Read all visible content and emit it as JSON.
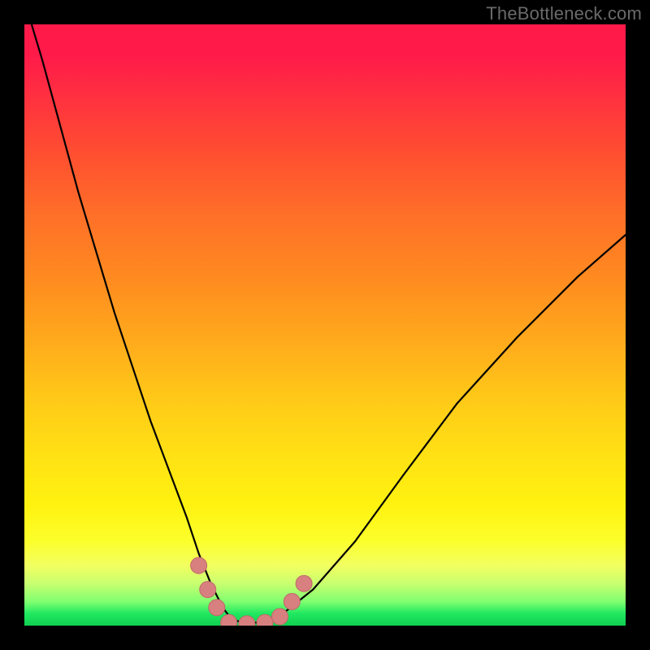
{
  "watermark": "TheBottleneck.com",
  "colors": {
    "background": "#000000",
    "curve": "#000000",
    "marker_fill": "#d88080",
    "marker_stroke": "#c06868",
    "gradient_top": "#ff1a4a",
    "gradient_bottom": "#10d050"
  },
  "chart_data": {
    "type": "line",
    "title": "",
    "xlabel": "",
    "ylabel": "",
    "xlim": [
      0,
      100
    ],
    "ylim": [
      0,
      100
    ],
    "grid": false,
    "legend": false,
    "annotations": [],
    "series": [
      {
        "name": "bottleneck-curve",
        "x": [
          0,
          3,
          6,
          9,
          12,
          15,
          18,
          21,
          24,
          27,
          29,
          31,
          33,
          34.5,
          36.5,
          39,
          43,
          48,
          55,
          63,
          72,
          82,
          92,
          100
        ],
        "values": [
          104,
          94,
          83,
          72,
          62,
          52,
          43,
          34,
          26,
          18,
          12,
          7,
          3,
          1,
          0.5,
          0.5,
          2,
          6,
          14,
          25,
          37,
          48,
          58,
          65
        ]
      }
    ],
    "markers": [
      {
        "name": "m1",
        "x": 29.0,
        "y": 10.0
      },
      {
        "name": "m2",
        "x": 30.5,
        "y": 6.0
      },
      {
        "name": "m3",
        "x": 32.0,
        "y": 3.0
      },
      {
        "name": "m4",
        "x": 34.0,
        "y": 0.5
      },
      {
        "name": "m5",
        "x": 37.0,
        "y": 0.3
      },
      {
        "name": "m6",
        "x": 40.0,
        "y": 0.5
      },
      {
        "name": "m7",
        "x": 42.5,
        "y": 1.5
      },
      {
        "name": "m8",
        "x": 44.5,
        "y": 4.0
      },
      {
        "name": "m9",
        "x": 46.5,
        "y": 7.0
      }
    ]
  }
}
